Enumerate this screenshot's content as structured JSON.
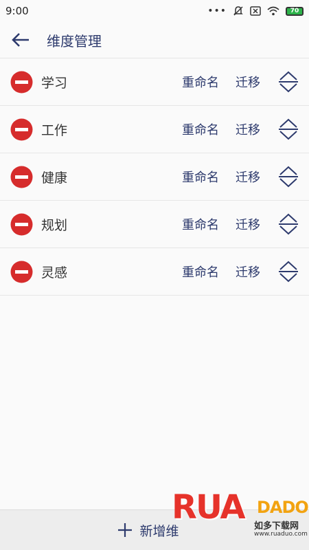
{
  "status": {
    "time": "9:00",
    "battery": "70"
  },
  "header": {
    "title": "维度管理"
  },
  "rows": [
    {
      "name": "学习",
      "rename": "重命名",
      "migrate": "迁移"
    },
    {
      "name": "工作",
      "rename": "重命名",
      "migrate": "迁移"
    },
    {
      "name": "健康",
      "rename": "重命名",
      "migrate": "迁移"
    },
    {
      "name": "规划",
      "rename": "重命名",
      "migrate": "迁移"
    },
    {
      "name": "灵感",
      "rename": "重命名",
      "migrate": "迁移"
    }
  ],
  "footer": {
    "add_label": "新增维"
  },
  "watermark": {
    "main": "RUA",
    "sub": "DADO",
    "cn": "如多下载网",
    "url": "www.ruaduo.com"
  },
  "colors": {
    "accent": "#2d3a6d",
    "delete": "#d62c2c",
    "battery": "#2db34a"
  }
}
